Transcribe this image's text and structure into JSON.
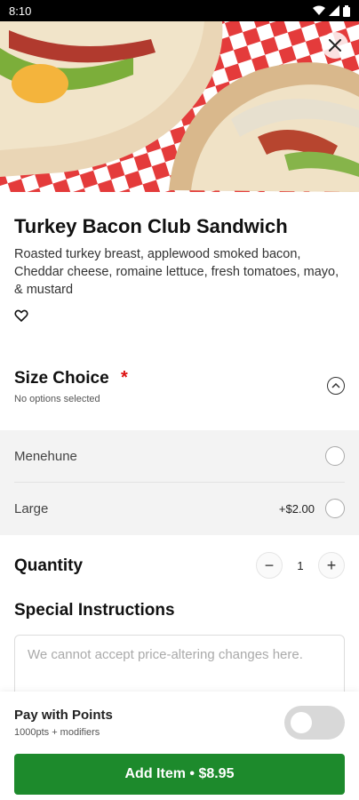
{
  "status_bar": {
    "time": "8:10"
  },
  "item": {
    "title": "Turkey Bacon Club Sandwich",
    "description": "Roasted turkey breast, applewood smoked bacon, Cheddar cheese, romaine lettuce, fresh tomatoes, mayo, & mustard"
  },
  "size_choice": {
    "title": "Size Choice",
    "required_mark": "*",
    "subtitle": "No options selected",
    "options": [
      {
        "label": "Menehune",
        "price": ""
      },
      {
        "label": "Large",
        "price": "+$2.00"
      }
    ]
  },
  "quantity": {
    "label": "Quantity",
    "value": "1",
    "minus": "−",
    "plus": "+"
  },
  "special_instructions": {
    "title": "Special Instructions",
    "placeholder": "We cannot accept price-altering changes here."
  },
  "points": {
    "title": "Pay with Points",
    "subtitle": "1000pts + modifiers"
  },
  "cta": {
    "label": "Add Item • $8.95"
  },
  "colors": {
    "accent_green": "#1d8a2c",
    "required_red": "#d11111"
  }
}
